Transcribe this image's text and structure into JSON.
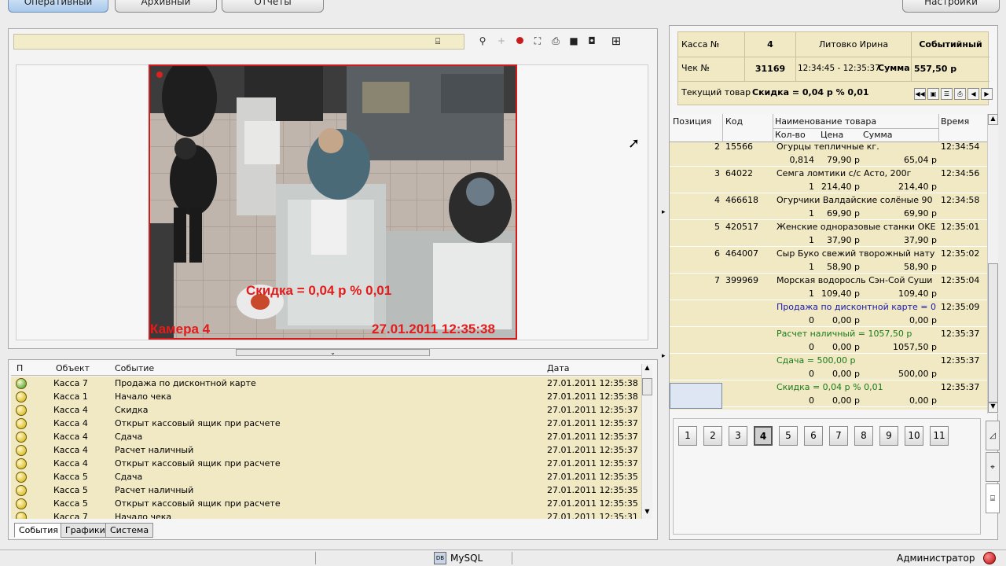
{
  "tabs": {
    "operative": "Оперативный",
    "archive": "Архивный",
    "reports": "Отчеты",
    "settings": "Настройки"
  },
  "video": {
    "camera_label": "Камера 4",
    "timestamp": "27.01.2011 12:35:38",
    "overlay": "Скидка = 0,04 р % 0,01",
    "recording_color": "#e02020"
  },
  "receipt": {
    "kassa_label": "Касса №",
    "kassa": "4",
    "cashier": "Литовко Ирина",
    "mode": "Событийный",
    "check_label": "Чек №",
    "check": "31169",
    "check_time": "12:34:45 - 12:35:37",
    "sum_label": "Сумма",
    "sum": "557,50 р",
    "current_label": "Текущий товар",
    "current": "Скидка = 0,04 р % 0,01"
  },
  "positions": {
    "headers": {
      "pos": "Позиция",
      "code": "Код",
      "name": "Наименование товара",
      "time": "Время",
      "qty": "Кол-во",
      "price": "Цена",
      "sum": "Сумма"
    },
    "rows": [
      {
        "pos": "2",
        "code": "15566",
        "name": "Огурцы тепличные кг.",
        "time": "12:34:54",
        "qty": "0,814",
        "price": "79,90 р",
        "sum": "65,04 р",
        "color": "#000000"
      },
      {
        "pos": "3",
        "code": "64022",
        "name": "Семга ломтики с/с Асто, 200г",
        "time": "12:34:56",
        "qty": "1",
        "price": "214,40 р",
        "sum": "214,40 р",
        "color": "#000000"
      },
      {
        "pos": "4",
        "code": "466618",
        "name": "Огурчики Валдайские солёные 90",
        "time": "12:34:58",
        "qty": "1",
        "price": "69,90 р",
        "sum": "69,90 р",
        "color": "#000000"
      },
      {
        "pos": "5",
        "code": "420517",
        "name": "Женские одноразовые станки OKE",
        "time": "12:35:01",
        "qty": "1",
        "price": "37,90 р",
        "sum": "37,90 р",
        "color": "#000000"
      },
      {
        "pos": "6",
        "code": "464007",
        "name": "Сыр Буко свежий творожный нату",
        "time": "12:35:02",
        "qty": "1",
        "price": "58,90 р",
        "sum": "58,90 р",
        "color": "#000000"
      },
      {
        "pos": "7",
        "code": "399969",
        "name": "Морская водоросль Сэн-Сой Суши",
        "time": "12:35:04",
        "qty": "1",
        "price": "109,40 р",
        "sum": "109,40 р",
        "color": "#000000"
      },
      {
        "pos": "",
        "code": "",
        "name": "Продажа по дисконтной карте = 0",
        "time": "12:35:09",
        "qty": "0",
        "price": "0,00 р",
        "sum": "0,00 р",
        "color": "#1a1aa8"
      },
      {
        "pos": "",
        "code": "",
        "name": "Расчет наличный = 1057,50 р",
        "time": "12:35:37",
        "qty": "0",
        "price": "0,00 р",
        "sum": "1057,50 р",
        "color": "#1a7a1a"
      },
      {
        "pos": "",
        "code": "",
        "name": "Сдача = 500,00 р",
        "time": "12:35:37",
        "qty": "0",
        "price": "0,00 р",
        "sum": "500,00 р",
        "color": "#1a7a1a"
      },
      {
        "pos": "",
        "code": "",
        "name": "Скидка = 0,04 р % 0,01",
        "time": "12:35:37",
        "qty": "0",
        "price": "0,00 р",
        "sum": "0,00 р",
        "color": "#1a7a1a"
      }
    ]
  },
  "kassa_buttons": [
    "1",
    "2",
    "3",
    "4",
    "5",
    "6",
    "7",
    "8",
    "9",
    "10",
    "11"
  ],
  "events": {
    "headers": {
      "p": "П",
      "object": "Объект",
      "event": "Событие",
      "date": "Дата"
    },
    "rows": [
      {
        "status": "green",
        "object": "Касса  7",
        "event": "Продажа по дисконтной карте",
        "date": "27.01.2011 12:35:38"
      },
      {
        "status": "yellow",
        "object": "Касса  1",
        "event": "Начало чека",
        "date": "27.01.2011 12:35:38"
      },
      {
        "status": "yellow",
        "object": "Касса  4",
        "event": "Скидка",
        "date": "27.01.2011 12:35:37"
      },
      {
        "status": "yellow",
        "object": "Касса  4",
        "event": "Открыт кассовый ящик при расчете",
        "date": "27.01.2011 12:35:37"
      },
      {
        "status": "yellow",
        "object": "Касса  4",
        "event": "Сдача",
        "date": "27.01.2011 12:35:37"
      },
      {
        "status": "yellow",
        "object": "Касса  4",
        "event": "Расчет наличный",
        "date": "27.01.2011 12:35:37"
      },
      {
        "status": "yellow",
        "object": "Касса  4",
        "event": "Открыт кассовый ящик при расчете",
        "date": "27.01.2011 12:35:37"
      },
      {
        "status": "yellow",
        "object": "Касса  5",
        "event": "Сдача",
        "date": "27.01.2011 12:35:35"
      },
      {
        "status": "yellow",
        "object": "Касса  5",
        "event": "Расчет наличный",
        "date": "27.01.2011 12:35:35"
      },
      {
        "status": "yellow",
        "object": "Касса  5",
        "event": "Открыт кассовый ящик при расчете",
        "date": "27.01.2011 12:35:35"
      },
      {
        "status": "yellow",
        "object": "Касса  7",
        "event": "Начало чека",
        "date": "27.01.2011 12:35:31"
      }
    ]
  },
  "bottom_tabs": {
    "events": "События",
    "graphs": "Графики",
    "system": "Система"
  },
  "status": {
    "db": "MySQL",
    "user": "Администратор"
  },
  "icons": {
    "green": "#2a9a1a",
    "yellow": "#d4b000"
  }
}
